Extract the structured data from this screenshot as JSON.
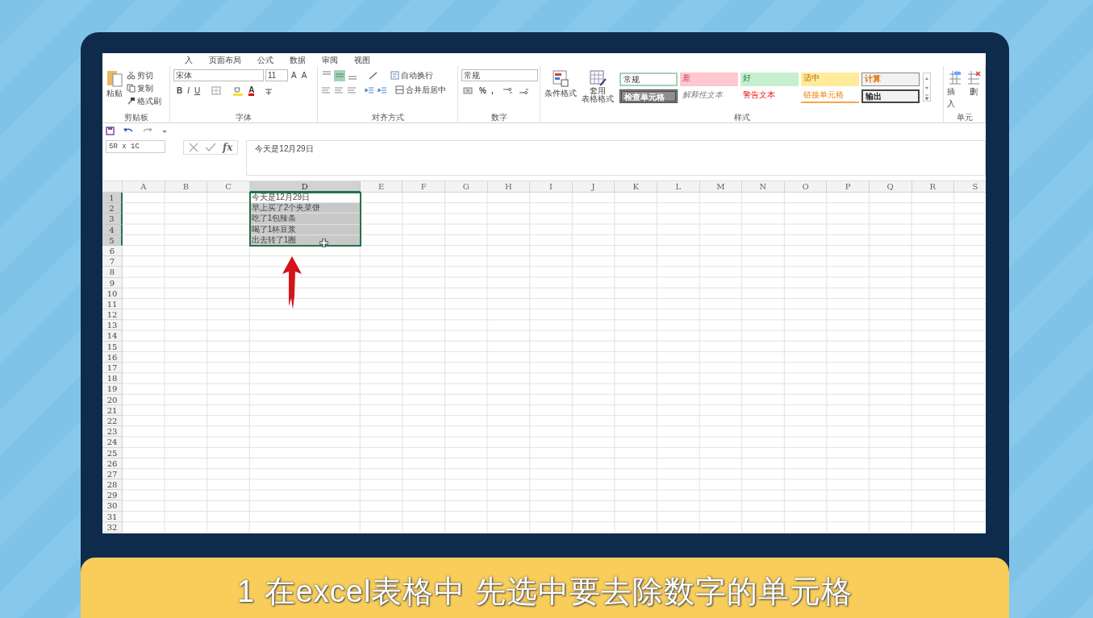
{
  "ribbon_tabs": [
    {
      "label": "入",
      "selected": false
    },
    {
      "label": "页面布局",
      "selected": false
    },
    {
      "label": "公式",
      "selected": false
    },
    {
      "label": "数据",
      "selected": false
    },
    {
      "label": "审阅",
      "selected": false
    },
    {
      "label": "视图",
      "selected": false
    }
  ],
  "clipboard": {
    "paste": "粘贴",
    "cut": "剪切",
    "copy": "复制",
    "format_painter": "格式刷",
    "group": "剪贴板"
  },
  "font": {
    "name": "宋体",
    "size": "11",
    "grow": "A",
    "shrink": "A",
    "format_buttons": [
      {
        "glyph": "B",
        "kind": "bold"
      },
      {
        "glyph": "I",
        "kind": "italic"
      },
      {
        "glyph": "U",
        "kind": "underline"
      }
    ],
    "color_glyph": "A",
    "group": "字体"
  },
  "alignment": {
    "vertical": [
      {
        "selected": false
      },
      {
        "selected": true
      },
      {
        "selected": false
      }
    ],
    "wrap": "自动换行",
    "merge": "合并后居中",
    "group": "对齐方式"
  },
  "number": {
    "format": "常规",
    "percent": "%",
    "comma": ",",
    "group": "数字"
  },
  "styles": {
    "conditional": "条件格式",
    "table_format": [
      "套用",
      "表格格式"
    ],
    "group": "样式",
    "cells": [
      {
        "label": "常规",
        "kind": "normal"
      },
      {
        "label": "差",
        "kind": "bad"
      },
      {
        "label": "好",
        "kind": "good"
      },
      {
        "label": "适中",
        "kind": "neutral"
      },
      {
        "label": "计算",
        "kind": "calculation"
      },
      {
        "label": "检查单元格",
        "kind": "check"
      },
      {
        "label": "解释性文本",
        "kind": "explanatory"
      },
      {
        "label": "警告文本",
        "kind": "warning"
      },
      {
        "label": "链接单元格",
        "kind": "linked"
      },
      {
        "label": "输出",
        "kind": "output"
      }
    ]
  },
  "cells_group": {
    "insert": "插入",
    "delete": "删",
    "group": "单元"
  },
  "name_box": "5R x 1C",
  "fx": "fx",
  "formula": "今天是12月29日",
  "columns": [
    {
      "label": "A",
      "selected": false
    },
    {
      "label": "B",
      "selected": false
    },
    {
      "label": "C",
      "selected": false
    },
    {
      "label": "D",
      "selected": true
    },
    {
      "label": "E",
      "selected": false
    },
    {
      "label": "F",
      "selected": false
    },
    {
      "label": "G",
      "selected": false
    },
    {
      "label": "H",
      "selected": false
    },
    {
      "label": "I",
      "selected": false
    },
    {
      "label": "J",
      "selected": false
    },
    {
      "label": "K",
      "selected": false
    },
    {
      "label": "L",
      "selected": false
    },
    {
      "label": "M",
      "selected": false
    },
    {
      "label": "N",
      "selected": false
    },
    {
      "label": "O",
      "selected": false
    },
    {
      "label": "P",
      "selected": false
    },
    {
      "label": "Q",
      "selected": false
    },
    {
      "label": "R",
      "selected": false
    },
    {
      "label": "S",
      "selected": false
    }
  ],
  "rows": [
    {
      "number": "1",
      "selected": true,
      "d": "今天是12月29日"
    },
    {
      "number": "2",
      "selected": true,
      "d": "早上买了2个夹菜饼"
    },
    {
      "number": "3",
      "selected": true,
      "d": "吃了1包辣条"
    },
    {
      "number": "4",
      "selected": true,
      "d": "喝了1杯豆浆"
    },
    {
      "number": "5",
      "selected": true,
      "d": "出去转了1圈"
    },
    {
      "number": "6",
      "selected": false
    },
    {
      "number": "7",
      "selected": false
    },
    {
      "number": "8",
      "selected": false
    },
    {
      "number": "9",
      "selected": false
    },
    {
      "number": "10",
      "selected": false
    },
    {
      "number": "11",
      "selected": false
    },
    {
      "number": "12",
      "selected": false
    },
    {
      "number": "13",
      "selected": false
    },
    {
      "number": "14",
      "selected": false
    },
    {
      "number": "15",
      "selected": false
    },
    {
      "number": "16",
      "selected": false
    },
    {
      "number": "17",
      "selected": false
    },
    {
      "number": "18",
      "selected": false
    },
    {
      "number": "19",
      "selected": false
    },
    {
      "number": "20",
      "selected": false
    },
    {
      "number": "21",
      "selected": false
    },
    {
      "number": "22",
      "selected": false
    },
    {
      "number": "23",
      "selected": false
    },
    {
      "number": "24",
      "selected": false
    },
    {
      "number": "25",
      "selected": false
    },
    {
      "number": "26",
      "selected": false
    },
    {
      "number": "27",
      "selected": false
    },
    {
      "number": "28",
      "selected": false
    },
    {
      "number": "29",
      "selected": false
    },
    {
      "number": "30",
      "selected": false
    },
    {
      "number": "31",
      "selected": false
    },
    {
      "number": "32",
      "selected": false
    }
  ],
  "caption": "1 在excel表格中 先选中要去除数字的单元格"
}
